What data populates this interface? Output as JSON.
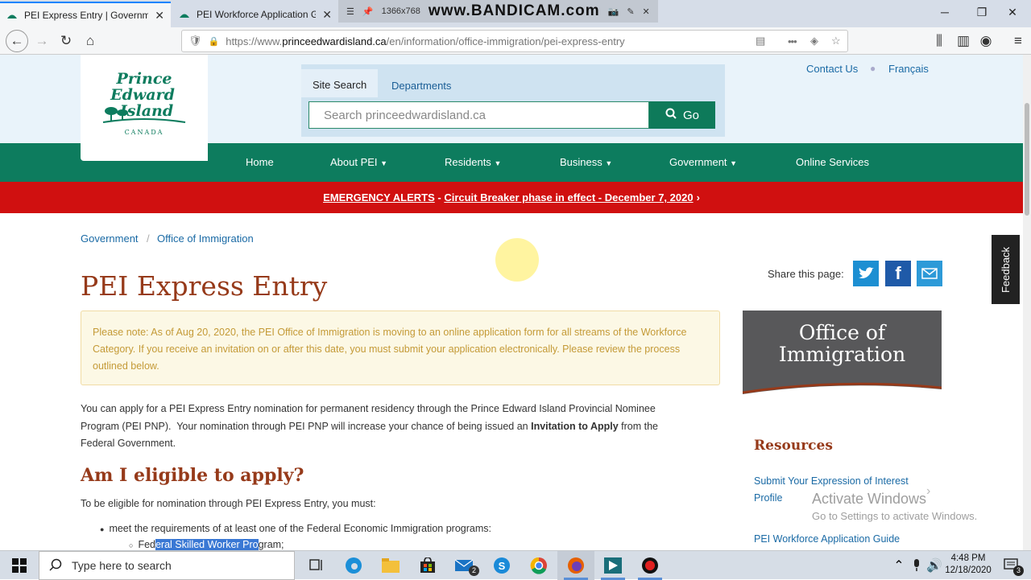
{
  "browser": {
    "tabs": [
      {
        "title": "PEI Express Entry | Government",
        "active": true
      },
      {
        "title": "PEI Workforce Application Guid",
        "active": false
      }
    ],
    "url_prefix": "https://www.",
    "url_host": "princeedwardisland.ca",
    "url_path": "/en/information/office-immigration/pei-express-entry",
    "recorder_size": "1366x768",
    "recorder_watermark": "www.BANDICAM.com"
  },
  "site": {
    "logo": {
      "line1": "Prince",
      "line2": "Edward",
      "line3": "Island",
      "country": "CANADA"
    },
    "search_tabs": [
      "Site Search",
      "Departments"
    ],
    "search_placeholder": "Search princeedwardisland.ca",
    "go_label": "Go",
    "top_links": [
      "Contact Us",
      "Français"
    ],
    "nav": [
      "Home",
      "About PEI",
      "Residents",
      "Business",
      "Government",
      "Online Services"
    ],
    "alert": {
      "label": "EMERGENCY ALERTS",
      "separator": " - ",
      "text": "Circuit Breaker phase in effect - December 7, 2020",
      "arrow": "›"
    }
  },
  "breadcrumb": [
    "Government",
    "Office of Immigration"
  ],
  "main": {
    "title": "PEI Express Entry",
    "share_label": "Share this page:",
    "note": "Please note: As of Aug 20, 2020, the PEI Office of Immigration is moving to an online application form for all streams of the Workforce Category. If you receive an invitation on or after this date, you must submit your application electronically. Please review the process outlined below.",
    "intro_1": "You can apply for a PEI Express Entry nomination for permanent residency through the Prince Edward Island Provincial Nominee",
    "intro_2a": "Program (PEI PNP).  Your nomination through PEI PNP will increase your chance of being issued an ",
    "intro_2b": "Invitation to Apply",
    "intro_2c": " from the",
    "intro_3": "Federal Government.",
    "eligibility_heading": "Am I eligible to apply?",
    "eligibility_text": "To be eligible for nomination through PEI Express Entry, you must:",
    "bullet_1": "meet the requirements of at least one of the Federal Economic Immigration programs:",
    "sub_bullet_a": "Fed",
    "sub_bullet_b": "eral Skilled Worker Pro",
    "sub_bullet_c": "gram;"
  },
  "sidebar": {
    "office_title": "Office of Immigration",
    "resources_heading": "Resources",
    "links": [
      "Submit Your Expression of Interest Profile",
      "PEI Workforce Application Guide"
    ]
  },
  "feedback": "Feedback",
  "overlay": {
    "activate_1": "Activate Windows",
    "activate_2": "Go to Settings to activate Windows."
  },
  "taskbar": {
    "search_placeholder": "Type here to search",
    "mail_badge": "2",
    "time": "4:48 PM",
    "date": "12/18/2020",
    "notif_count": "3"
  },
  "colors": {
    "brand_green": "#0d7c5e",
    "alert_red": "#d01010",
    "heading_brown": "#963a1a",
    "link_blue": "#1a6aa5"
  }
}
